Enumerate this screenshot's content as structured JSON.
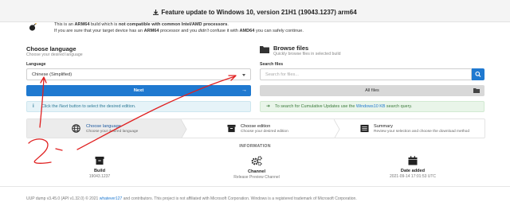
{
  "header": {
    "title": "Feature update to Windows 10, version 21H1 (19043.1237) arm64"
  },
  "warning": {
    "line1_pre": "This is an ",
    "line1_b1": "ARM64",
    "line1_mid": " build which is ",
    "line1_b2": "not compatible with common Intel/AMD processors",
    "line1_end": ".",
    "line2_pre": "If you are sure that your target device has an ",
    "line2_b1": "ARM64",
    "line2_mid": " processor and you ",
    "line2_em": "didn't",
    "line2_mid2": " confuse it with ",
    "line2_b2": "AMD64",
    "line2_end": " you can safely continue."
  },
  "language_section": {
    "title": "Choose language",
    "subtitle": "Choose your desired language",
    "field_label": "Language",
    "selected": "Chinese (Simplified)",
    "next_label": "Next",
    "info_pre": "Click the ",
    "info_em": "Next",
    "info_post": " button to select the desired edition."
  },
  "files_section": {
    "title": "Browse files",
    "subtitle": "Quickly browse files in selected build",
    "field_label": "Search files",
    "placeholder": "Search for files...",
    "all_files_label": "All files",
    "tip_pre": "To search for Cumulative Updates use the ",
    "tip_link": "Windows10 KB",
    "tip_post": " search query."
  },
  "steps": [
    {
      "title": "Choose language",
      "subtitle": "Choose your desired language"
    },
    {
      "title": "Choose edition",
      "subtitle": "Choose your desired edition"
    },
    {
      "title": "Summary",
      "subtitle": "Review your selection and choose the download method"
    }
  ],
  "information": {
    "heading": "INFORMATION",
    "build_label": "Build",
    "build_value": "19043.1237",
    "channel_label": "Channel",
    "channel_value": "Release Preview Channel",
    "date_label": "Date added",
    "date_value": "2021-09-14 17:01:53 UTC"
  },
  "footer": {
    "p1": "UUP dump v3.45.0 (API v1.32.0) © 2021 ",
    "link": "whatever127",
    "p2": " and contributors. This project is not affiliated with Microsoft Corporation. Windows is a registered trademark of Microsoft Corporation."
  },
  "colors": {
    "primary": "#1f79d0",
    "info_bg": "#e6f3f8",
    "success_bg": "#e9f5e9",
    "annotation": "#e02020"
  }
}
